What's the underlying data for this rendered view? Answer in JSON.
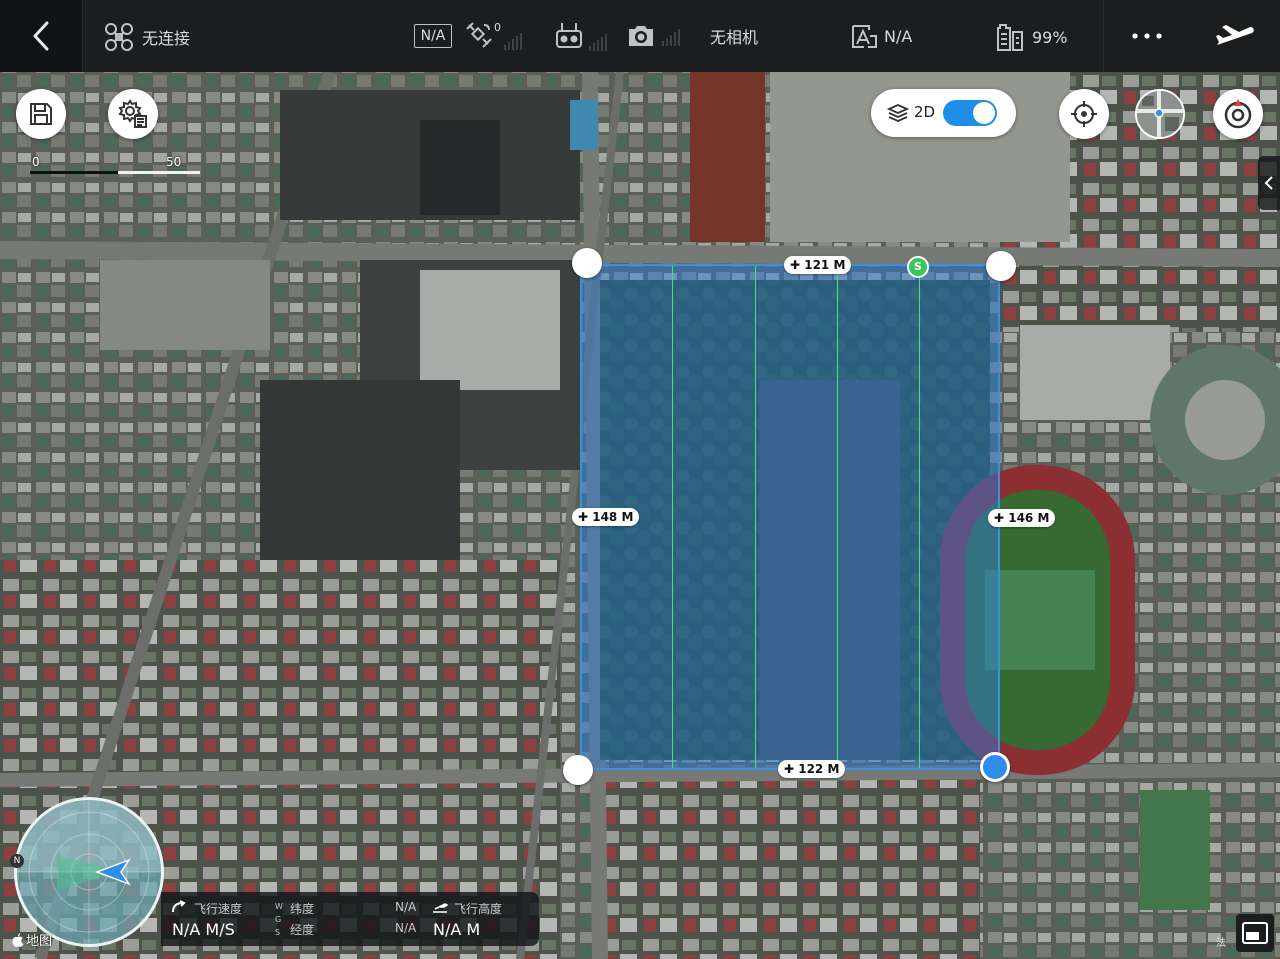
{
  "topbar": {
    "connection_status": "无连接",
    "gps_mode": "N/A",
    "satellite_count": "0",
    "camera_status": "无相机",
    "storage_value": "N/A",
    "battery_percent": "99%"
  },
  "map": {
    "scale": {
      "start": "0",
      "end": "50"
    },
    "mode_label": "2D",
    "mode_toggle_on": true
  },
  "survey_area": {
    "top_length": "121 M",
    "bottom_length": "122 M",
    "left_length": "148 M",
    "right_length": "146 M",
    "start_marker": "S"
  },
  "telemetry": {
    "speed_label": "飞行速度",
    "speed_value": "N/A M/S",
    "coord_system": "WGS",
    "lat_label": "纬度",
    "lon_label": "经度",
    "lat_value": "N/A",
    "lon_value": "N/A",
    "altitude_label": "飞行高度",
    "altitude_value": "N/A M"
  },
  "radar": {
    "north": "N"
  },
  "attribution": {
    "maps": "地图",
    "legal": "法"
  },
  "colors": {
    "accent": "#1e9be0",
    "survey_fill": "#2d7ddc",
    "lane": "#41e86a",
    "topbar": "#1b1d1f"
  }
}
